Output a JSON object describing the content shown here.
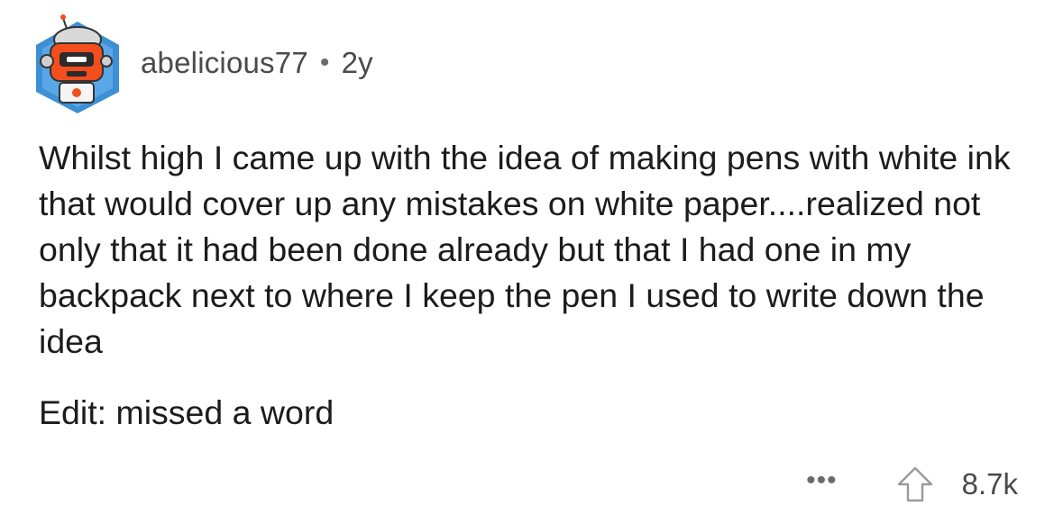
{
  "comment": {
    "author": "abelicious77",
    "separator": "•",
    "age": "2y",
    "avatar_icon": "robot-avatar-icon",
    "paragraphs": [
      "Whilst high I came up with the idea of making pens with white ink that would cover up any mistakes on white paper....realized not only that it had been done already but that I had one in my backpack next to where I keep the pen I used to write down the idea",
      "Edit: missed a word"
    ],
    "actions": {
      "more_label": "•••",
      "upvote_icon": "upvote-arrow-icon",
      "score": "8.7k"
    }
  },
  "colors": {
    "avatar_bg": "#3d8fd6",
    "robot_orange": "#f24e1e",
    "text": "#1c1c1c",
    "muted": "#4a4a4a"
  }
}
